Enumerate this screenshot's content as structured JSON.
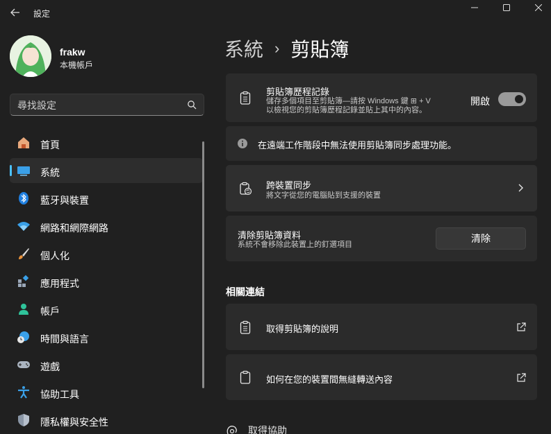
{
  "window": {
    "title": "設定",
    "back_icon": "arrow-left-icon",
    "controls": [
      "minimize-icon",
      "maximize-icon",
      "close-icon"
    ]
  },
  "profile": {
    "name": "frakw",
    "account_type": "本機帳戶"
  },
  "search": {
    "placeholder": "尋找設定",
    "value": ""
  },
  "nav": {
    "items": [
      {
        "label": "首頁",
        "icon": "home-icon",
        "active": false
      },
      {
        "label": "系統",
        "icon": "system-icon",
        "active": true
      },
      {
        "label": "藍牙與裝置",
        "icon": "bluetooth-icon",
        "active": false
      },
      {
        "label": "網路和網際網路",
        "icon": "wifi-icon",
        "active": false
      },
      {
        "label": "個人化",
        "icon": "brush-icon",
        "active": false
      },
      {
        "label": "應用程式",
        "icon": "apps-icon",
        "active": false
      },
      {
        "label": "帳戶",
        "icon": "account-icon",
        "active": false
      },
      {
        "label": "時間與語言",
        "icon": "time-language-icon",
        "active": false
      },
      {
        "label": "遊戲",
        "icon": "gamepad-icon",
        "active": false
      },
      {
        "label": "協助工具",
        "icon": "accessibility-icon",
        "active": false
      },
      {
        "label": "隱私權與安全性",
        "icon": "shield-icon",
        "active": false
      }
    ]
  },
  "breadcrumb": {
    "parent": "系統",
    "separator": "›",
    "current": "剪貼簿"
  },
  "cards": {
    "history": {
      "title": "剪貼簿歷程記錄",
      "desc_line1": "儲存多個項目至剪貼簿—請按 Windows 鍵 ⊞ + V",
      "desc_line2": "以檢視您的剪貼簿歷程記錄並貼上其中的內容。",
      "toggle_label": "開啟",
      "toggle_on": true
    },
    "info": {
      "text": "在遠端工作階段中無法使用剪貼簿同步處理功能。"
    },
    "sync": {
      "title": "跨裝置同步",
      "desc": "將文字從您的電腦貼到支援的裝置"
    },
    "clear": {
      "title": "清除剪貼簿資料",
      "desc": "系統不會移除此裝置上的釘選項目",
      "button": "清除"
    }
  },
  "related": {
    "heading": "相關連結",
    "links": [
      {
        "label": "取得剪貼簿的說明",
        "icon": "clipboard-list-icon"
      },
      {
        "label": "如何在您的裝置間無縫轉送內容",
        "icon": "clipboard-icon"
      }
    ]
  },
  "help": {
    "label": "取得協助"
  },
  "colors": {
    "background": "#202020",
    "card": "#2b2b2b",
    "accent": "#4cc2ff"
  }
}
